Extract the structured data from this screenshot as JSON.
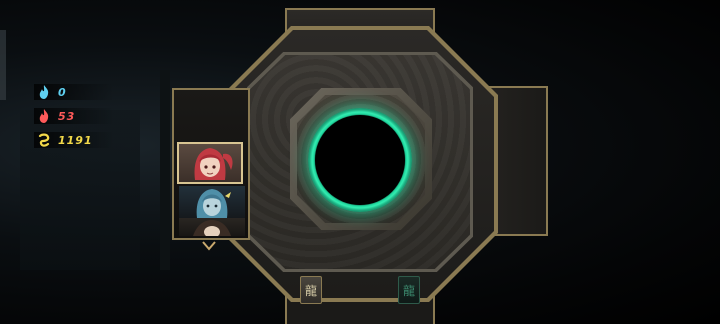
{
  "resources": [
    {
      "icon": "blue-flame-icon",
      "value": "0",
      "color": "#5fd0f0"
    },
    {
      "icon": "red-flame-icon",
      "value": "53",
      "color": "#ff5a5a"
    },
    {
      "icon": "gold-coin-icon",
      "value": "1191",
      "color": "#f2d94a"
    }
  ],
  "characters": [
    {
      "name": "red-haired-character",
      "selected": true
    },
    {
      "name": "blue-haired-character",
      "selected": false
    },
    {
      "name": "third-character",
      "selected": false
    }
  ],
  "seals": {
    "left_glyph": "龍",
    "right_glyph": "龍"
  },
  "colors": {
    "frame_gold": "#8a7a52",
    "portal_glow": "#38f0b4"
  }
}
